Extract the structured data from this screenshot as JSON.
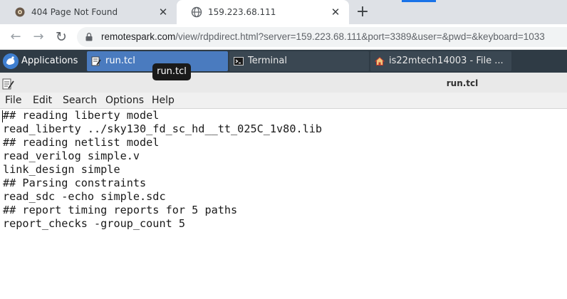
{
  "browser": {
    "tabs": [
      {
        "title": "404 Page Not Found",
        "favicon": "gear-favicon-icon",
        "active": false
      },
      {
        "title": "159.223.68.111",
        "favicon": "globe-icon",
        "active": true
      }
    ],
    "close_glyph": "✕",
    "new_tab_glyph": "+",
    "url_host": "remotespark.com",
    "url_path": "/view/rdpdirect.html?server=159.223.68.111&port=3389&user=&pwd=&keyboard=1033"
  },
  "panel": {
    "applications_label": "Applications",
    "tasks": [
      {
        "label": "run.tcl",
        "icon": "editor-icon"
      },
      {
        "label": "Terminal",
        "icon": "terminal-icon"
      },
      {
        "label": "is22mtech14003 - File ...",
        "icon": "home-folder-icon"
      }
    ],
    "tooltip": "run.tcl"
  },
  "editor": {
    "window_title": "run.tcl",
    "menu": [
      "File",
      "Edit",
      "Search",
      "Options",
      "Help"
    ],
    "lines": [
      "## reading liberty model",
      "read_liberty ../sky130_fd_sc_hd__tt_025C_1v80.lib",
      "## reading netlist model",
      "read_verilog simple.v",
      "link_design simple",
      "## Parsing constraints",
      "read_sdc -echo simple.sdc",
      "## report timing reports for 5 paths",
      "report_checks -group_count 5"
    ]
  },
  "colors": {
    "panel_bg": "#2f3b45",
    "active_task": "#4a7bbf",
    "chrome_strip": "#dee1e6"
  }
}
